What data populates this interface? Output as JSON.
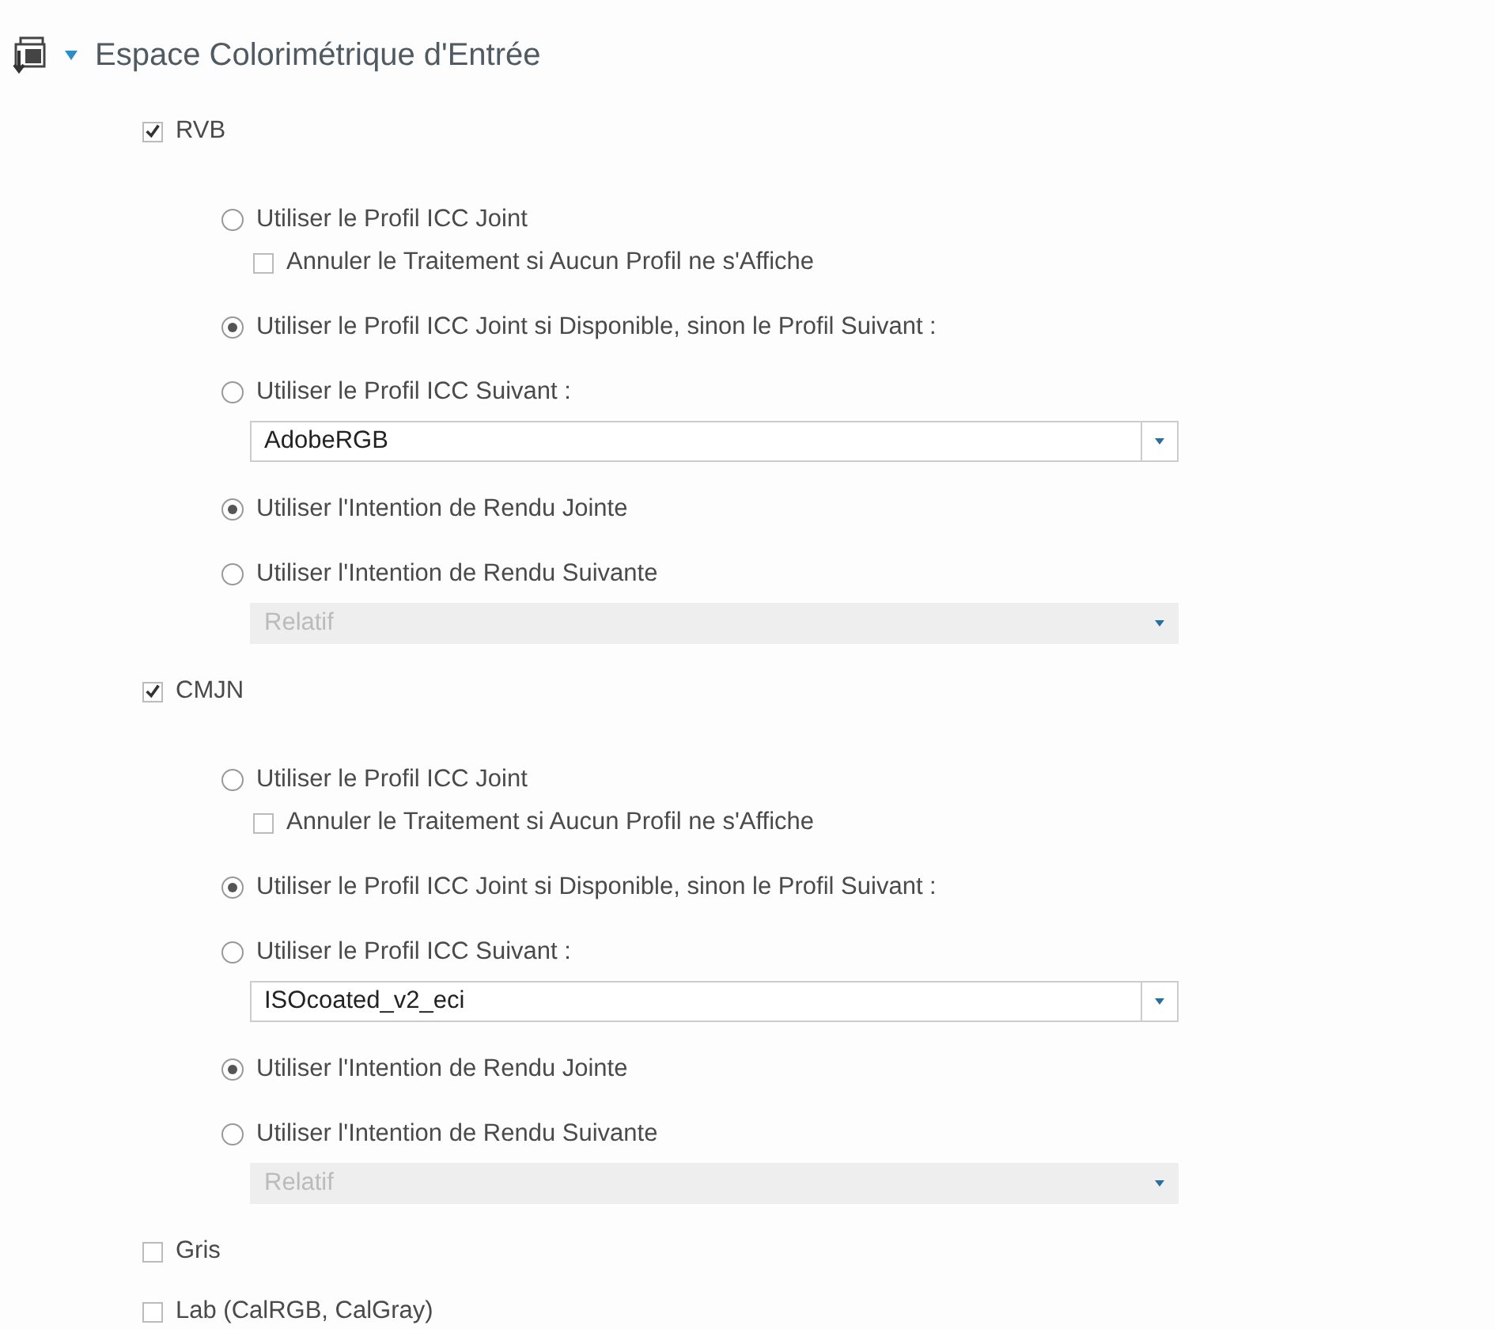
{
  "section": {
    "title": "Espace Colorimétrique d'Entrée",
    "expanded": true
  },
  "color_spaces": [
    {
      "label": "RVB",
      "checked": true,
      "options": [
        {
          "label": "Utiliser le Profil ICC Joint",
          "selected": false,
          "sub_checkbox": {
            "label": "Annuler le Traitement si Aucun Profil ne s'Affiche",
            "checked": false
          }
        },
        {
          "label": "Utiliser le Profil ICC Joint si Disponible, sinon le Profil Suivant :",
          "selected": true
        },
        {
          "label": "Utiliser le Profil ICC Suivant :",
          "selected": false,
          "dropdown": {
            "value": "AdobeRGB",
            "disabled": false
          }
        },
        {
          "label": "Utiliser l'Intention de Rendu Jointe",
          "selected": true
        },
        {
          "label": "Utiliser l'Intention de Rendu Suivante",
          "selected": false,
          "dropdown": {
            "value": "Relatif",
            "disabled": true
          }
        }
      ]
    },
    {
      "label": "CMJN",
      "checked": true,
      "options": [
        {
          "label": "Utiliser le Profil ICC Joint",
          "selected": false,
          "sub_checkbox": {
            "label": "Annuler le Traitement si Aucun Profil ne s'Affiche",
            "checked": false
          }
        },
        {
          "label": "Utiliser le Profil ICC Joint si Disponible, sinon le Profil Suivant :",
          "selected": true
        },
        {
          "label": "Utiliser le Profil ICC Suivant :",
          "selected": false,
          "dropdown": {
            "value": "ISOcoated_v2_eci",
            "disabled": false
          }
        },
        {
          "label": "Utiliser l'Intention de Rendu Jointe",
          "selected": true
        },
        {
          "label": "Utiliser l'Intention de Rendu Suivante",
          "selected": false,
          "dropdown": {
            "value": "Relatif",
            "disabled": true
          }
        }
      ]
    },
    {
      "label": "Gris",
      "checked": false
    },
    {
      "label": "Lab (CalRGB, CalGray)",
      "checked": false
    }
  ]
}
